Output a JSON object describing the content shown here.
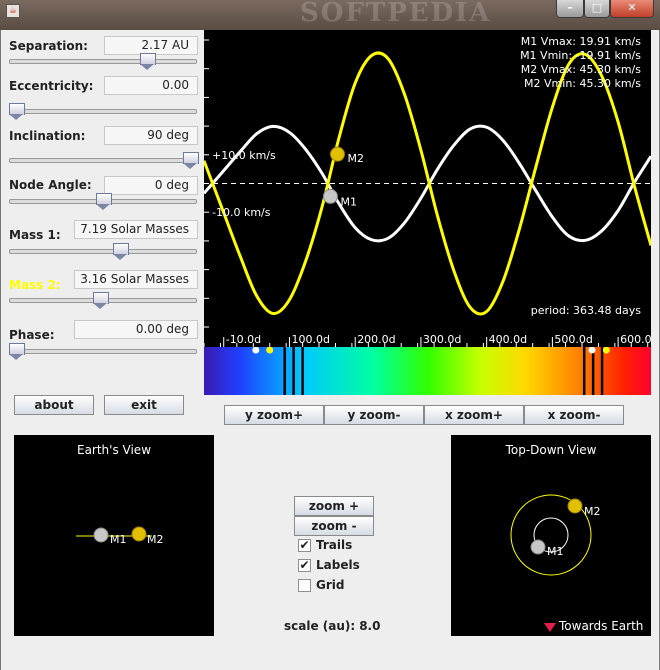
{
  "window": {
    "watermark": "SOFTPEDIA"
  },
  "controls": {
    "separation": {
      "label": "Separation:",
      "value": "2.17 AU",
      "fraction": 0.75
    },
    "eccentricity": {
      "label": "Eccentricity:",
      "value": "0.00",
      "fraction": 0.0
    },
    "inclination": {
      "label": "Inclination:",
      "value": "90 deg",
      "fraction": 1.0
    },
    "node_angle": {
      "label": "Node Angle:",
      "value": "0 deg",
      "fraction": 0.5
    },
    "mass1": {
      "label": "Mass 1:",
      "value": "7.19 Solar Masses",
      "fraction": 0.6
    },
    "mass2": {
      "label": "Mass 2:",
      "value": "3.16 Solar Masses",
      "fraction": 0.48,
      "color": "#ffff00"
    },
    "phase": {
      "label": "Phase:",
      "value": "0.00 deg",
      "fraction": 0.0
    }
  },
  "buttons": {
    "about": "about",
    "exit": "exit",
    "y_zoom_in": "y zoom+",
    "y_zoom_out": "y zoom-",
    "x_zoom_in": "x zoom+",
    "x_zoom_out": "x zoom-",
    "zoom_in": "zoom +",
    "zoom_out": "zoom -"
  },
  "checkboxes": {
    "trails": {
      "label": "Trails",
      "checked": true
    },
    "labels": {
      "label": "Labels",
      "checked": true
    },
    "grid": {
      "label": "Grid",
      "checked": false
    }
  },
  "scale": {
    "label": "scale (au):",
    "value": "8.0"
  },
  "chart_data": {
    "type": "line",
    "x": [
      0,
      25,
      50,
      75,
      100,
      125,
      150,
      175,
      200,
      225,
      250,
      275,
      300,
      325,
      350,
      375,
      400,
      425,
      450,
      475,
      500,
      525,
      550,
      575,
      600,
      625,
      650
    ],
    "series": [
      {
        "name": "M1",
        "color": "#ffffff",
        "values": [
          4.5,
          11.1,
          17.3,
          19.9,
          17.8,
          11.8,
          3.4,
          -6.9,
          -15.4,
          -19.6,
          -19.1,
          -13.7,
          -5.1,
          4.9,
          13.3,
          19.0,
          19.6,
          15.0,
          6.9,
          -2.6,
          -11.7,
          -18.3,
          -19.8,
          -16.5,
          -9.4,
          0.5,
          9.5
        ]
      },
      {
        "name": "M2",
        "color": "#ffff00",
        "values": [
          -10.2,
          -25.3,
          -39.1,
          -45.3,
          -40.5,
          -26.8,
          -7.8,
          15.6,
          35.0,
          44.6,
          43.5,
          31.1,
          11.6,
          -11.1,
          -30.3,
          -43.2,
          -44.6,
          -34.0,
          -15.7,
          5.9,
          26.6,
          41.6,
          45.0,
          37.5,
          21.4,
          -1.1,
          -21.6
        ]
      }
    ],
    "xlim": [
      -30,
      650
    ],
    "ylim": [
      -50,
      50
    ],
    "x_tick_labels": [
      "-10.0d",
      "100.0d",
      "200.0d",
      "300.0d",
      "400.0d",
      "500.0d",
      "600.0d"
    ],
    "x_ticks": [
      0,
      100,
      200,
      300,
      400,
      500,
      600
    ],
    "y_ref_labels": [
      {
        "text": "+10.0 km/s",
        "value": 10
      },
      {
        "text": "-10.0 km/s",
        "value": -10
      }
    ],
    "stats": [
      "M1 Vmax:  19.91 km/s",
      "M1 Vmin:  -19.91 km/s",
      "M2 Vmax:  45.30 km/s",
      "M2 Vmin:  45.30 km/s"
    ],
    "period": "period: 363.48 days",
    "marker_labels": {
      "m1": "M1",
      "m2": "M2"
    },
    "markers": {
      "m1_x": 170,
      "m2_x": 170
    },
    "grid": false,
    "zero_line": "dashed",
    "spectrum_lines": [
      0.18,
      0.2,
      0.22,
      0.85,
      0.87,
      0.89
    ]
  },
  "earth_view": {
    "title": "Earth's View",
    "m1": "M1",
    "m2": "M2"
  },
  "top_view": {
    "title": "Top-Down View",
    "m1": "M1",
    "m2": "M2",
    "towards": "Towards Earth"
  }
}
